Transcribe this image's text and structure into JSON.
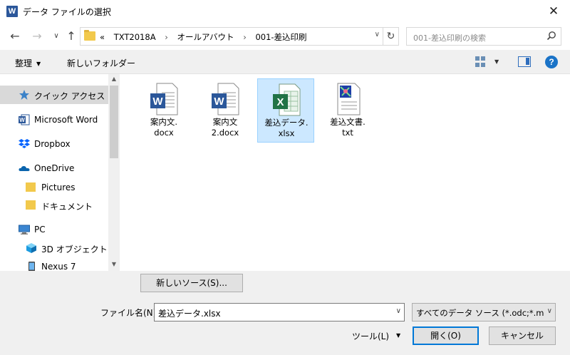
{
  "window": {
    "title": "データ ファイルの選択",
    "app_icon_letter": "W",
    "close_glyph": "✕"
  },
  "nav": {
    "back_glyph": "←",
    "forward_glyph": "→",
    "recent_glyph": "∨",
    "up_glyph": "↑",
    "breadcrumbs": [
      "«",
      "TXT2018A",
      "オールアバウト",
      "001-差込印刷"
    ],
    "separator": "›",
    "address_dropdown_glyph": "∨",
    "refresh_glyph": "↻",
    "search_placeholder": "001-差込印刷の検索"
  },
  "toolbar": {
    "organize_label": "整理",
    "caret": "▼",
    "new_folder_label": "新しいフォルダー",
    "help_glyph": "?"
  },
  "sidebar": {
    "items": [
      {
        "label": "クイック アクセス",
        "icon": "star-icon"
      },
      {
        "label": "Microsoft Word",
        "icon": "word-icon"
      },
      {
        "label": "Dropbox",
        "icon": "dropbox-icon"
      },
      {
        "label": "OneDrive",
        "icon": "onedrive-icon"
      },
      {
        "label": "Pictures",
        "icon": "folder-icon"
      },
      {
        "label": "ドキュメント",
        "icon": "folder-icon"
      },
      {
        "label": "PC",
        "icon": "pc-icon"
      },
      {
        "label": "3D オブジェクト",
        "icon": "3d-objects-icon"
      },
      {
        "label": "Nexus 7",
        "icon": "device-icon"
      }
    ],
    "scroll_up_glyph": "▲",
    "scroll_down_glyph": "▼"
  },
  "files": [
    {
      "name_line1": "案内文.",
      "name_line2": "docx",
      "type": "word-document-icon"
    },
    {
      "name_line1": "案内文",
      "name_line2": "2.docx",
      "type": "word-document-icon"
    },
    {
      "name_line1": "差込データ.",
      "name_line2": "xlsx",
      "type": "excel-workbook-icon",
      "selected": true
    },
    {
      "name_line1": "差込文書.",
      "name_line2": "txt",
      "type": "text-document-icon"
    }
  ],
  "bottom": {
    "new_source_label": "新しいソース(S)...",
    "filename_label": "ファイル名(N):",
    "filename_value": "差込データ.xlsx",
    "filter_value": "すべてのデータ ソース (*.odc;*.mdb",
    "dropdown_glyph": "∨",
    "tools_label": "ツール(L)",
    "open_label": "開く(O)",
    "cancel_label": "キャンセル"
  },
  "colors": {
    "word_blue": "#2b579a",
    "excel_green": "#217346",
    "selection": "#cce8ff",
    "accent": "#0078d7"
  }
}
